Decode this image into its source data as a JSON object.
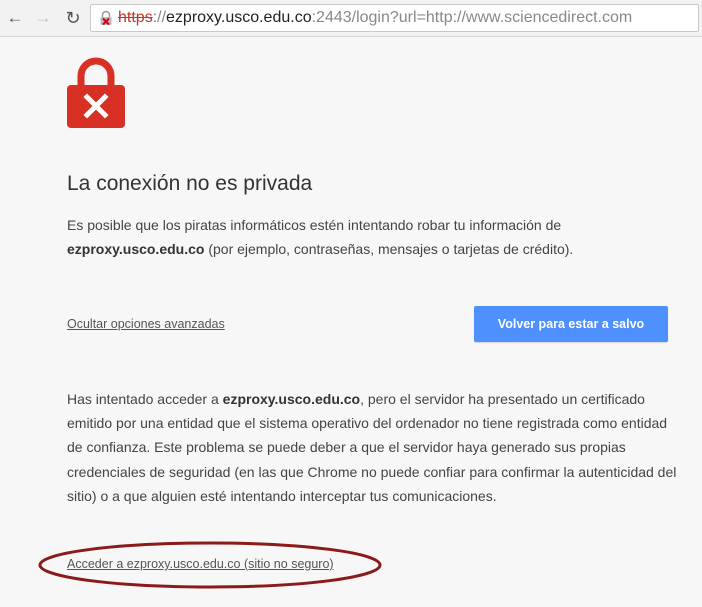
{
  "toolbar": {
    "back_icon": "arrow-left-icon",
    "forward_icon": "arrow-right-icon",
    "reload_icon": "reload-icon",
    "url_scheme": "https",
    "url_sep": "://",
    "url_host": "ezproxy.usco.edu.co",
    "url_rest": ":2443/login?url=http://www.sciencedirect.com"
  },
  "page": {
    "title": "La conexión no es privada",
    "intro_part1": "Es posible que los piratas informáticos estén intentando robar tu información de ",
    "intro_host": "ezproxy.usco.edu.co",
    "intro_part2": " (por ejemplo, contraseñas, mensajes o tarjetas de crédito).",
    "advanced_link": "Ocultar opciones avanzadas",
    "safe_button": "Volver para estar a salvo",
    "details_part1": "Has intentado acceder a ",
    "details_host": "ezproxy.usco.edu.co",
    "details_part2": ", pero el servidor ha presentado un certificado emitido por una entidad que el sistema operativo del ordenador no tiene registrada como entidad de confianza. Este problema se puede deber a que el servidor haya generado sus propias credenciales de seguridad (en las que Chrome no puede confiar para confirmar la autenticidad del sitio) o a que alguien esté intentando interceptar tus comunicaciones.",
    "proceed_link": "Acceder a ezproxy.usco.edu.co (sitio no seguro)"
  },
  "colors": {
    "lock_red": "#d93025",
    "button_blue": "#4d90fe",
    "annotation_red": "#8b1a1a"
  }
}
